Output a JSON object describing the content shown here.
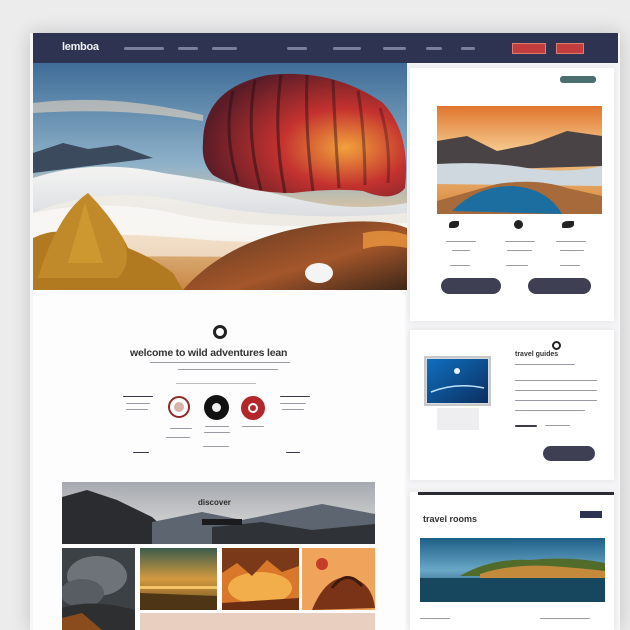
{
  "header": {
    "logo": "lemboa",
    "actions": [
      "",
      ""
    ]
  },
  "hero": {
    "alt": "hot air balloon above clouds"
  },
  "intro": {
    "headline": "welcome to wild adventures lean"
  },
  "sidebar": {
    "video_title": "travel guides",
    "gallery_title": "travel rooms"
  },
  "gallery": {
    "banner_title": "discover"
  },
  "colors": {
    "nav": "#2d3350",
    "accent": "#c23e3e",
    "button_dark": "#3e3f52"
  }
}
